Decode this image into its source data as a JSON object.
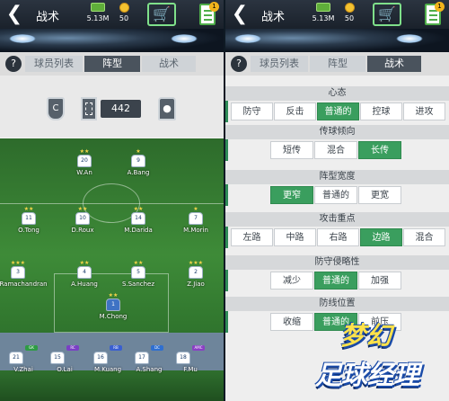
{
  "screens": [
    {
      "title": "战术",
      "cash": "5.13M",
      "coins": "50",
      "badge": "1",
      "tabs": [
        {
          "label": "球员列表",
          "active": false
        },
        {
          "label": "阵型",
          "active": true
        },
        {
          "label": "战术",
          "active": false
        }
      ],
      "formation_score": "442",
      "starters": [
        {
          "name": "W.An",
          "number": "20"
        },
        {
          "name": "A.Bang",
          "number": "9"
        },
        {
          "name": "O.Tong",
          "number": "11"
        },
        {
          "name": "D.Roux",
          "number": "10"
        },
        {
          "name": "M.Darida",
          "number": "14"
        },
        {
          "name": "M.Morin",
          "number": "7"
        },
        {
          "name": "O.Ramachandran",
          "number": "3"
        },
        {
          "name": "A.Huang",
          "number": "4"
        },
        {
          "name": "S.Sanchez",
          "number": "5"
        },
        {
          "name": "Z.Jiao",
          "number": "2"
        },
        {
          "name": "M.Chong",
          "number": "1"
        }
      ],
      "bench": [
        {
          "name": "V.Zhai",
          "number": "21",
          "tag": "GK"
        },
        {
          "name": "O.Lai",
          "number": "15",
          "tag": "RC"
        },
        {
          "name": "M.Kuang",
          "number": "16",
          "tag": "RB"
        },
        {
          "name": "A.Shang",
          "number": "17",
          "tag": "DC"
        },
        {
          "name": "F.Mu",
          "number": "18",
          "tag": "AMC"
        }
      ]
    },
    {
      "title": "战术",
      "cash": "5.13M",
      "coins": "50",
      "badge": "1",
      "tabs": [
        {
          "label": "球员列表",
          "active": false
        },
        {
          "label": "阵型",
          "active": false
        },
        {
          "label": "战术",
          "active": true
        }
      ],
      "sections": [
        {
          "heading": "心态",
          "options": [
            "防守",
            "反击",
            "普通的",
            "控球",
            "进攻"
          ],
          "selected": 2
        },
        {
          "heading": "传球倾向",
          "options": [
            "短传",
            "混合",
            "长传"
          ],
          "selected": 2
        },
        {
          "heading": "阵型宽度",
          "options": [
            "更窄",
            "普通的",
            "更宽"
          ],
          "selected": 0
        },
        {
          "heading": "攻击重点",
          "options": [
            "左路",
            "中路",
            "右路",
            "边路",
            "混合"
          ],
          "selected": 3
        },
        {
          "heading": "防守侵略性",
          "options": [
            "减少",
            "普通的",
            "加强"
          ],
          "selected": 1
        },
        {
          "heading": "防线位置",
          "options": [
            "收缩",
            "普通的",
            "前压"
          ],
          "selected": 1
        }
      ]
    }
  ],
  "logo": {
    "line1": "梦幻",
    "line2": "足球经理"
  },
  "colors": {
    "accent": "#3a9e5e",
    "header": "#2b3440"
  }
}
